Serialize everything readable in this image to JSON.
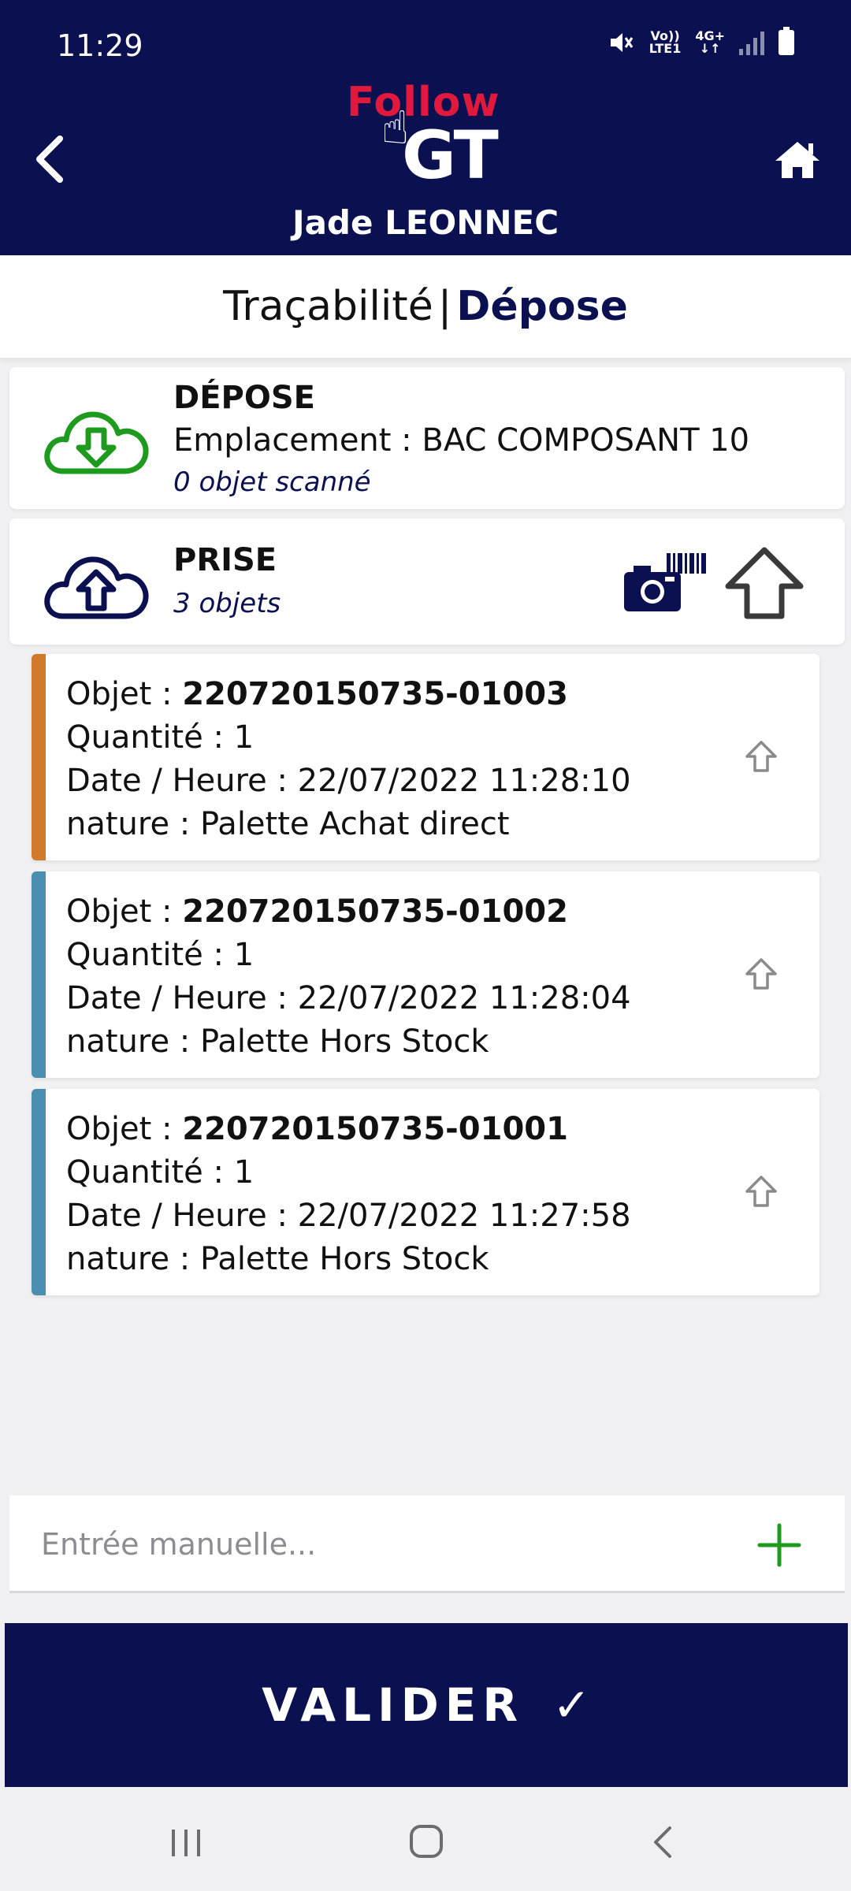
{
  "status_bar": {
    "time": "11:29",
    "network_label_top": "Vo))",
    "network_label_bottom": "LTE1",
    "network_type": "4G+"
  },
  "header": {
    "logo_text_top": "Follow",
    "logo_text_bottom": "GT",
    "user_name": "Jade LEONNEC",
    "background_color": "#0b1150",
    "logo_accent_color": "#e1193c"
  },
  "breadcrumb": {
    "section": "Traçabilité",
    "separator": "|",
    "current": "Dépose"
  },
  "depose_card": {
    "title": "DÉPOSE",
    "location_line": "Emplacement : BAC COMPOSANT 10",
    "scanned_count": "0 objet scanné",
    "icon": "cloud-download-icon",
    "icon_color": "#1e9a1e"
  },
  "prise_card": {
    "title": "PRISE",
    "object_count": "3 objets",
    "icon": "cloud-upload-icon"
  },
  "objects": {
    "labels": {
      "object": "Objet : ",
      "quantity": "Quantité : ",
      "datetime": "Date / Heure : ",
      "nature": "nature : "
    },
    "items": [
      {
        "id": "220720150735-01003",
        "quantity": "1",
        "datetime": "22/07/2022 11:28:10",
        "nature": "Palette Achat direct",
        "color": "#d07a2e"
      },
      {
        "id": "220720150735-01002",
        "quantity": "1",
        "datetime": "22/07/2022 11:28:04",
        "nature": "Palette Hors Stock",
        "color": "#4a8fb0"
      },
      {
        "id": "220720150735-01001",
        "quantity": "1",
        "datetime": "22/07/2022 11:27:58",
        "nature": "Palette Hors Stock",
        "color": "#4a8fb0"
      }
    ]
  },
  "manual_entry": {
    "placeholder": "Entrée manuelle...",
    "value": ""
  },
  "validate_button": {
    "label": "VALIDER",
    "check": "✓"
  }
}
